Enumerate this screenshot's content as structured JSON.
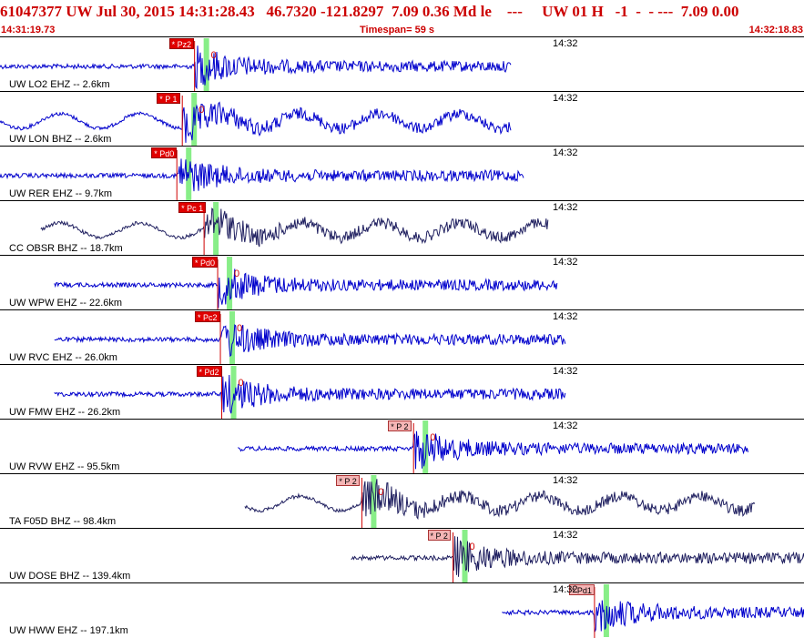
{
  "header": {
    "title": "61047377 UW Jul 30, 2015 14:31:28.43   46.7320 -121.8297  7.09 0.36 Md le    ---     UW 01 H   -1  -  - ---  7.09 0.00",
    "start_time": "14:31:19.73",
    "timespan": "Timespan=  59 s",
    "end_time": "14:32:18.83"
  },
  "colors": {
    "header": "#cc0000",
    "trace_blue": "#0000cc",
    "trace_navy": "#202060",
    "pick_red": "#e00000",
    "pick_soft": "#f4b4b4",
    "window_green": "#88ee88"
  },
  "minute_mark": "14:32",
  "channels": [
    {
      "label": "UW LO2 EHZ -- 2.6km",
      "pick": "* Pz2",
      "pick_style": "hard",
      "pick_time": 14.3,
      "data_start": 0.0,
      "data_end": 37.6,
      "amp_label": "0"
    },
    {
      "label": "UW LON BHZ -- 2.6km",
      "pick": "* P 1",
      "pick_style": "hard",
      "pick_time": 13.4,
      "data_start": 0.0,
      "data_end": 37.6,
      "amp_label": "0"
    },
    {
      "label": "UW RER EHZ -- 9.7km",
      "pick": "* Pd0",
      "pick_style": "hard",
      "pick_time": 13.0,
      "data_start": 0.0,
      "data_end": 38.5,
      "amp_label": ""
    },
    {
      "label": "CC OBSR BHZ -- 18.7km",
      "pick": "* Pc 1",
      "pick_style": "hard",
      "pick_time": 15.0,
      "data_start": 3.0,
      "data_end": 40.3,
      "amp_label": ""
    },
    {
      "label": "UW WPW EHZ -- 22.6km",
      "pick": "* Pd0",
      "pick_style": "hard",
      "pick_time": 16.0,
      "data_start": 4.0,
      "data_end": 41.0,
      "amp_label": "0"
    },
    {
      "label": "UW RVC EHZ -- 26.0km",
      "pick": "* Pc2",
      "pick_style": "hard",
      "pick_time": 16.2,
      "data_start": 4.0,
      "data_end": 41.6,
      "amp_label": "0"
    },
    {
      "label": "UW FMW EHZ -- 26.2km",
      "pick": "* Pd2",
      "pick_style": "hard",
      "pick_time": 16.3,
      "data_start": 4.0,
      "data_end": 41.6,
      "amp_label": "0"
    },
    {
      "label": "UW RVW EHZ -- 95.5km",
      "pick": "* P 2",
      "pick_style": "soft",
      "pick_time": 30.4,
      "data_start": 17.5,
      "data_end": 55.0,
      "amp_label": "0"
    },
    {
      "label": "TA F05D BHZ -- 98.4km",
      "pick": "* P 2",
      "pick_style": "soft",
      "pick_time": 26.6,
      "data_start": 18.0,
      "data_end": 55.5,
      "amp_label": "0"
    },
    {
      "label": "UW DOSE BHZ -- 139.4km",
      "pick": "* P 2",
      "pick_style": "soft",
      "pick_time": 33.3,
      "data_start": 25.8,
      "data_end": 63.3,
      "amp_label": "0"
    },
    {
      "label": "UW HWW EHZ -- 197.1km",
      "pick": "* Pd1",
      "pick_style": "soft",
      "pick_time": 43.7,
      "data_start": 36.9,
      "data_end": 74.0,
      "amp_label": ""
    }
  ]
}
